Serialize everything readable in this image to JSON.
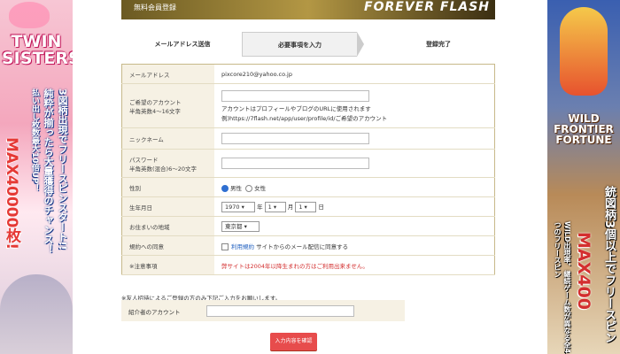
{
  "left_banner": {
    "title": "TWIN SISTERS",
    "vertical_1": "3図柄出現でフリースピンスタート!!",
    "vertical_2": "純粋が揃ったら大量獲得のチャンス！",
    "vertical_3": "払い出し枚数最大10倍UP！",
    "max_text": "MAX40000枚!"
  },
  "right_banner": {
    "title": "WILD FRONTIER FORTUNE",
    "vertical_1": "銃図柄3個以上でフリースピン",
    "vertical_2": "WILD出現率、継続ゲーム数が異なる全4つのフリースピン",
    "max_text": "MAX400"
  },
  "header": {
    "title": "無料会員登録",
    "logo": "FOREVER FLASH"
  },
  "steps": [
    "メールアドレス送信",
    "必要事項を入力",
    "登録完了"
  ],
  "form": {
    "email_label": "メールアドレス",
    "email_value": "pixcore210@yahoo.co.jp",
    "account_label": "ご希望のアカウント",
    "account_sub": "半角英数4〜16文字",
    "account_help": "アカウントはプロフィールやブログのURLに使用されます",
    "account_example": "例)https://7flash.net/app/user/profile/id/ご希望のアカウント",
    "nickname_label": "ニックネーム",
    "password_label": "パスワード",
    "password_sub": "半角英数(混合)6〜20文字",
    "gender_label": "性別",
    "gender_male": "男性",
    "gender_female": "女性",
    "birth_label": "生年月日",
    "birth_year": "1970",
    "birth_year_unit": "年",
    "birth_month": "1",
    "birth_month_unit": "月",
    "birth_day": "1",
    "birth_day_unit": "日",
    "area_label": "お住まいの地域",
    "area_value": "東京都",
    "terms_label": "規約への同意",
    "terms_link": "利用規約",
    "terms_text": "サイトからのメール配信に同意する",
    "notice_label": "※注意事項",
    "notice_text": "弊サイトは2004年以降生まれの方はご利用出来ません。"
  },
  "invite_note": "※友人招待によるご登録の方のみ下記ご入力をお願いします。",
  "referrer_label": "紹介者のアカウント",
  "submit_label": "入力内容を確認"
}
